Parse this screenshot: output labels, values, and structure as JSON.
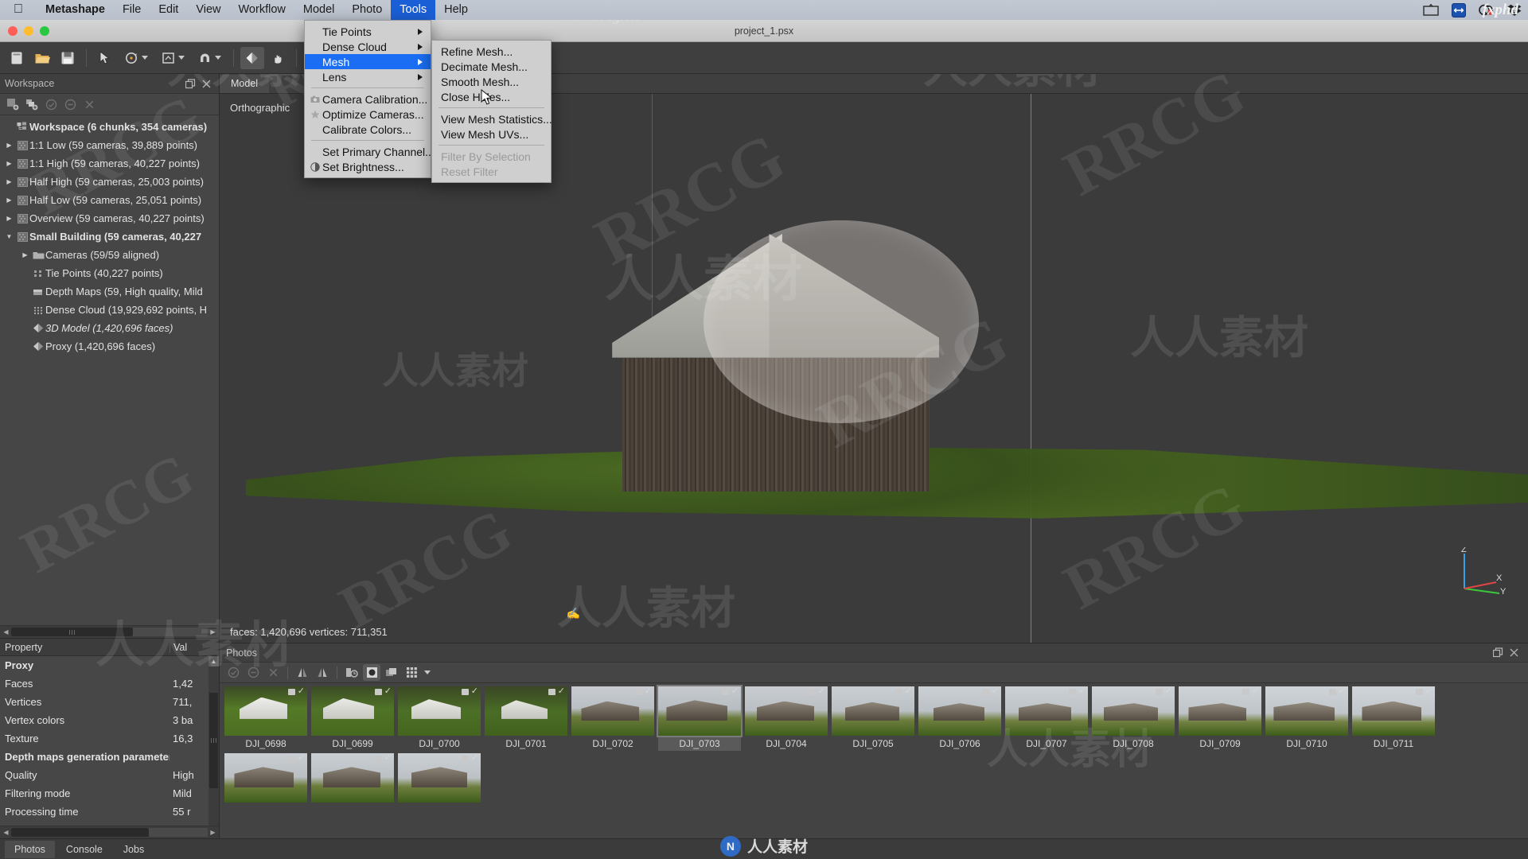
{
  "macbar": {
    "apple_icon": "apple-icon",
    "app_name": "Metashape",
    "menus": [
      "File",
      "Edit",
      "View",
      "Workflow",
      "Model",
      "Photo",
      "Tools",
      "Help"
    ],
    "active_menu": "Tools",
    "status_icons": [
      "screen-icon",
      "arrows-icon",
      "teamviewer-icon",
      "dropbox-icon"
    ],
    "brand": "fxphd"
  },
  "titlebar": {
    "title": "project_1.psx"
  },
  "tools_menu": {
    "items": [
      {
        "label": "Tie Points",
        "submenu": true,
        "icon": ""
      },
      {
        "label": "Dense Cloud",
        "submenu": true,
        "icon": ""
      },
      {
        "label": "Mesh",
        "submenu": true,
        "highlighted": true,
        "icon": ""
      },
      {
        "label": "Lens",
        "submenu": true,
        "icon": ""
      },
      {
        "separator": true
      },
      {
        "label": "Camera Calibration...",
        "icon": "camera-icon"
      },
      {
        "label": "Optimize Cameras...",
        "icon": "star-icon"
      },
      {
        "label": "Calibrate Colors...",
        "icon": ""
      },
      {
        "separator": true
      },
      {
        "label": "Set Primary Channel...",
        "icon": ""
      },
      {
        "label": "Set Brightness...",
        "icon": "brightness-icon"
      }
    ]
  },
  "mesh_submenu": {
    "items": [
      {
        "label": "Refine Mesh..."
      },
      {
        "label": "Decimate Mesh..."
      },
      {
        "label": "Smooth Mesh..."
      },
      {
        "label": "Close Holes..."
      },
      {
        "separator": true
      },
      {
        "label": "View Mesh Statistics..."
      },
      {
        "label": "View Mesh UVs..."
      },
      {
        "separator": true
      },
      {
        "label": "Filter By Selection",
        "disabled": true
      },
      {
        "label": "Reset Filter",
        "disabled": true
      }
    ]
  },
  "workspace": {
    "title": "Workspace",
    "panel_buttons": [
      "undock-icon",
      "close-icon"
    ],
    "toolbar": [
      "add-chunk-icon",
      "add-photos-icon",
      "enable-icon",
      "disable-icon",
      "remove-icon"
    ],
    "tree": [
      {
        "label": "Workspace (6 chunks, 354 cameras)",
        "depth": 0,
        "arrow": "none",
        "icon": "workspace-icon",
        "bold": true
      },
      {
        "label": "1:1 Low (59 cameras, 39,889 points)",
        "depth": 1,
        "arrow": "right",
        "icon": "chunk-icon"
      },
      {
        "label": "1:1 High (59 cameras, 40,227 points)",
        "depth": 1,
        "arrow": "right",
        "icon": "chunk-icon"
      },
      {
        "label": "Half High (59 cameras, 25,003 points)",
        "depth": 1,
        "arrow": "right",
        "icon": "chunk-icon"
      },
      {
        "label": "Half Low (59 cameras, 25,051 points)",
        "depth": 1,
        "arrow": "right",
        "icon": "chunk-icon"
      },
      {
        "label": "Overview (59 cameras, 40,227 points)",
        "depth": 1,
        "arrow": "right",
        "icon": "chunk-icon"
      },
      {
        "label": "Small Building (59 cameras, 40,227",
        "depth": 1,
        "arrow": "down",
        "icon": "chunk-icon",
        "bold": true
      },
      {
        "label": "Cameras (59/59 aligned)",
        "depth": 2,
        "arrow": "right",
        "icon": "folder-icon"
      },
      {
        "label": "Tie Points (40,227 points)",
        "depth": 2,
        "arrow": "none",
        "icon": "tiepoints-icon"
      },
      {
        "label": "Depth Maps (59, High quality, Mild",
        "depth": 2,
        "arrow": "none",
        "icon": "depthmaps-icon"
      },
      {
        "label": "Dense Cloud (19,929,692 points, H",
        "depth": 2,
        "arrow": "none",
        "icon": "densecloud-icon"
      },
      {
        "label": "3D Model (1,420,696 faces)",
        "depth": 2,
        "arrow": "none",
        "icon": "model-icon",
        "italic": true
      },
      {
        "label": "Proxy (1,420,696 faces)",
        "depth": 2,
        "arrow": "none",
        "icon": "model-icon"
      }
    ]
  },
  "property_panel": {
    "columns": [
      "Property",
      "Val"
    ],
    "rows": [
      {
        "key": "Proxy",
        "value": "",
        "header": true
      },
      {
        "key": "Faces",
        "value": "1,42"
      },
      {
        "key": "Vertices",
        "value": "711,"
      },
      {
        "key": "Vertex colors",
        "value": "3 ba"
      },
      {
        "key": "Texture",
        "value": "16,3"
      },
      {
        "key": "Depth maps generation parameters",
        "value": "",
        "header": true
      },
      {
        "key": "Quality",
        "value": "High"
      },
      {
        "key": "Filtering mode",
        "value": "Mild"
      },
      {
        "key": "Processing time",
        "value": "55 r"
      }
    ]
  },
  "model_view": {
    "tab": "Model",
    "projection": "Orthographic",
    "stats": "faces: 1,420,696 vertices: 711,351",
    "axis_labels": [
      "Z",
      "X",
      "Y"
    ]
  },
  "photos_panel": {
    "title": "Photos",
    "panel_buttons": [
      "undock-icon",
      "close-icon"
    ],
    "toolbar": [
      "enable-icon",
      "disable-icon",
      "remove-icon",
      "rotate-left-icon",
      "rotate-right-icon",
      "reset-icon",
      "mask-icon",
      "duplicate-icon",
      "grid-icon",
      "chevron-down-icon"
    ],
    "row1": [
      {
        "name": "DJI_0698",
        "type": "aerial-light"
      },
      {
        "name": "DJI_0699",
        "type": "aerial-light"
      },
      {
        "name": "DJI_0700",
        "type": "aerial-light"
      },
      {
        "name": "DJI_0701",
        "type": "aerial-light"
      },
      {
        "name": "DJI_0702",
        "type": "ground"
      },
      {
        "name": "DJI_0703",
        "type": "ground",
        "selected": true
      },
      {
        "name": "DJI_0704",
        "type": "ground"
      },
      {
        "name": "DJI_0705",
        "type": "ground"
      },
      {
        "name": "DJI_0706",
        "type": "ground"
      },
      {
        "name": "DJI_0707",
        "type": "ground"
      },
      {
        "name": "DJI_0708",
        "type": "ground"
      },
      {
        "name": "DJI_0709",
        "type": "ground"
      },
      {
        "name": "DJI_0710",
        "type": "ground"
      },
      {
        "name": "DJI_0711",
        "type": "ground"
      }
    ],
    "row2": [
      {
        "name": "",
        "type": "ground"
      },
      {
        "name": "",
        "type": "ground"
      },
      {
        "name": "",
        "type": "ground"
      }
    ]
  },
  "bottom_tabs": {
    "tabs": [
      "Photos",
      "Console",
      "Jobs"
    ],
    "active": "Photos"
  },
  "watermarks": {
    "url": "www.rrcg.cn",
    "brand_latin": "RRCG",
    "brand_cn": "人人素材",
    "footer_cn": "人人素材"
  },
  "colors": {
    "menu_highlight": "#1b6ef3",
    "macbar_active": "#1b5fd6",
    "panel_bg": "#434343",
    "viewport_bg": "#3b3b3b"
  }
}
